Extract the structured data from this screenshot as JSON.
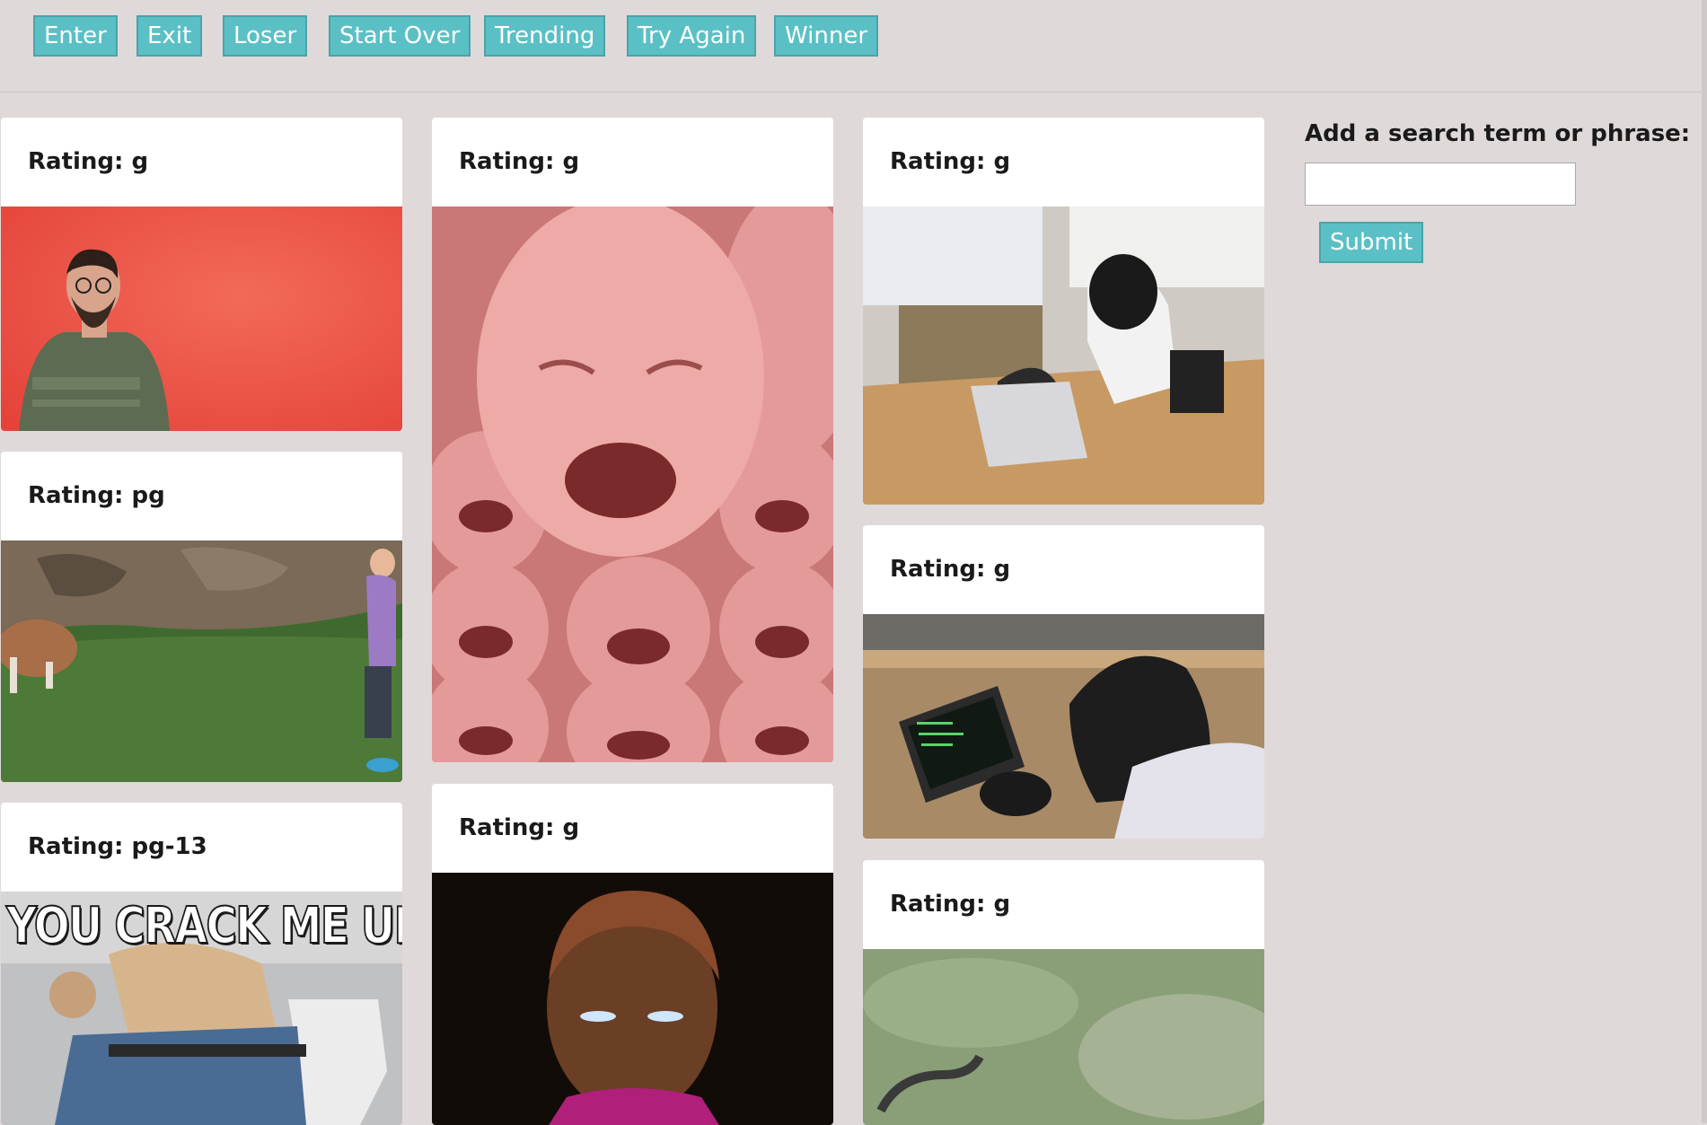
{
  "topics": [
    "Enter",
    "Exit",
    "Loser",
    "Start Over",
    "Trending",
    "Try Again",
    "Winner"
  ],
  "search": {
    "label": "Add a search term or phrase:",
    "value": "",
    "placeholder": "",
    "submit_label": "Submit"
  },
  "results": [
    {
      "rating_label": "Rating: g",
      "image_text": ""
    },
    {
      "rating_label": "Rating: pg",
      "image_text": ""
    },
    {
      "rating_label": "Rating: pg-13",
      "image_text": "YOU CRACK ME UP"
    },
    {
      "rating_label": "Rating: g",
      "image_text": ""
    },
    {
      "rating_label": "Rating: g",
      "image_text": ""
    },
    {
      "rating_label": "Rating: g",
      "image_text": ""
    },
    {
      "rating_label": "Rating: g",
      "image_text": ""
    },
    {
      "rating_label": "Rating: g",
      "image_text": ""
    }
  ]
}
